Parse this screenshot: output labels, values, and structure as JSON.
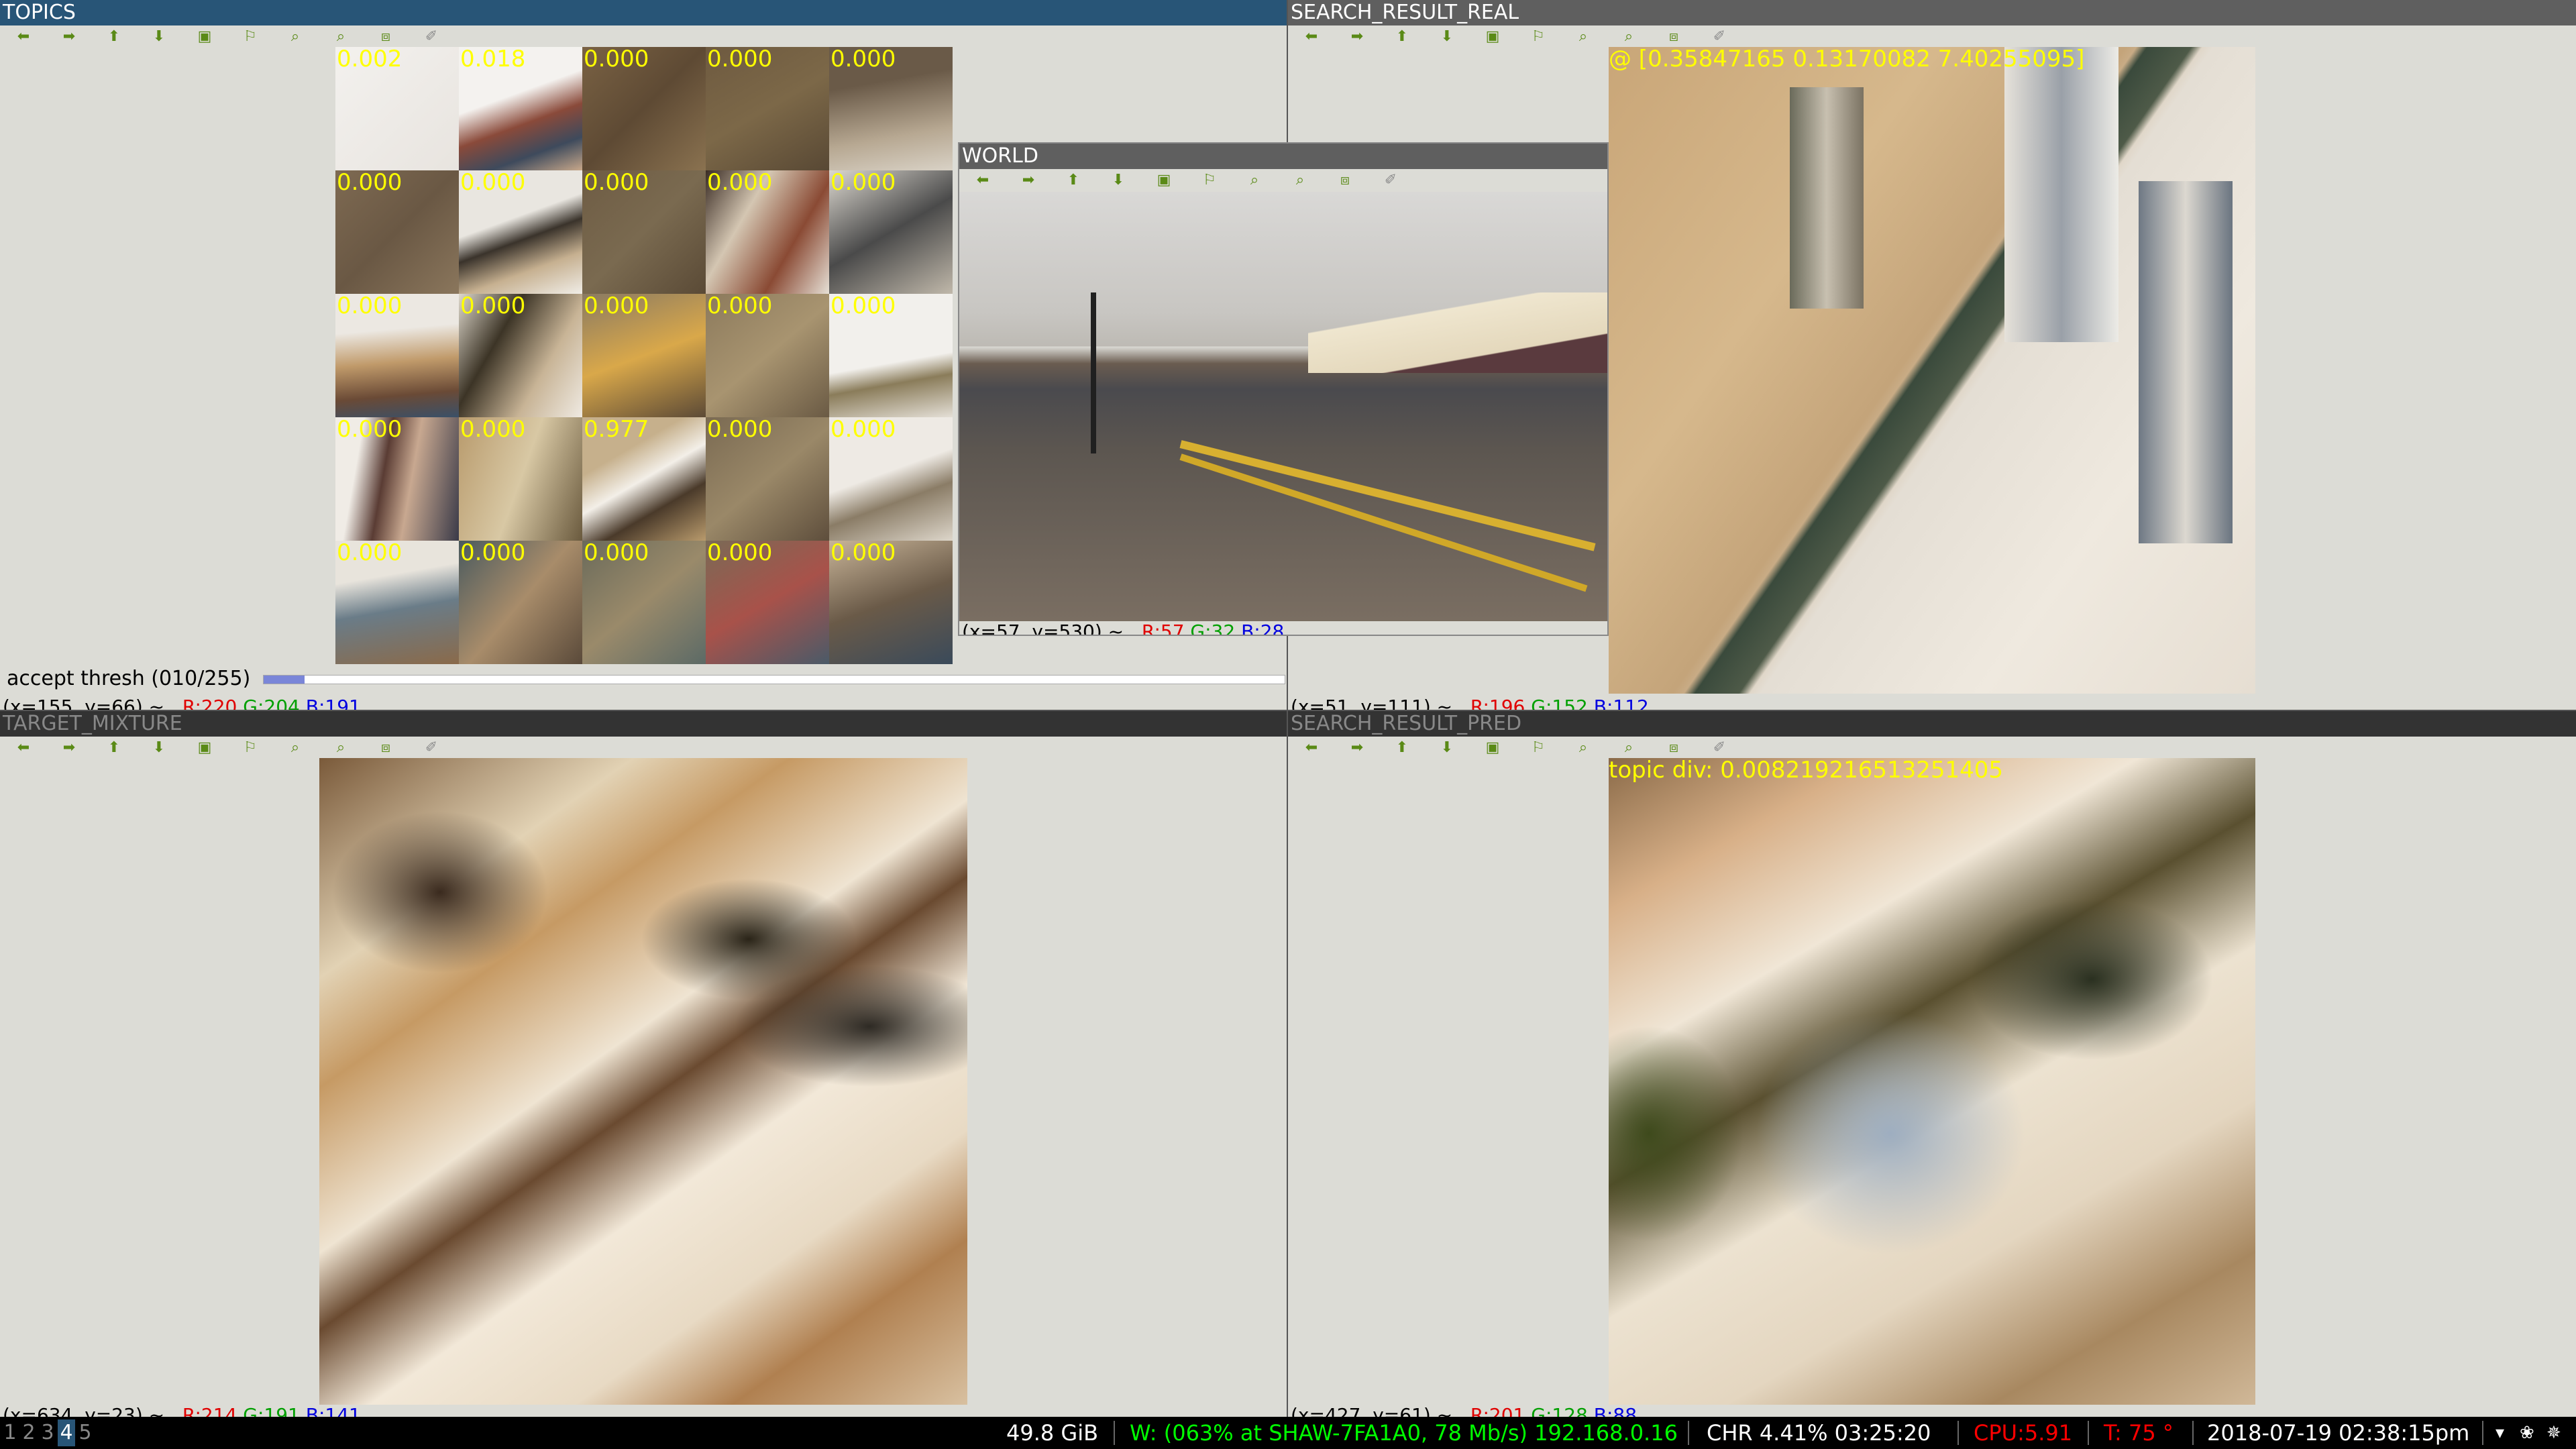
{
  "windows": {
    "topics": {
      "title": "TOPICS",
      "accept_label": "accept thresh (010/255)",
      "slider_level": 0.04,
      "coords": {
        "pos": "(x=155, y=66) ~",
        "r": "R:220",
        "g": "G:204",
        "b": "B:191"
      },
      "grid_values": [
        "0.002",
        "0.018",
        "0.000",
        "0.000",
        "0.000",
        "0.000",
        "0.000",
        "0.000",
        "0.000",
        "0.000",
        "0.000",
        "0.000",
        "0.000",
        "0.000",
        "0.000",
        "0.000",
        "0.000",
        "0.977",
        "0.000",
        "0.000",
        "0.000",
        "0.000",
        "0.000",
        "0.000",
        "0.000"
      ]
    },
    "world": {
      "title": "WORLD",
      "coords": {
        "pos": "(x=57, y=530) ~",
        "r": "R:57",
        "g": "G:32",
        "b": "B:28"
      }
    },
    "search_result_real": {
      "title": "SEARCH_RESULT_REAL",
      "overlay": "@ [0.35847165 0.13170082 7.40255095]",
      "coords": {
        "pos": "(x=51, y=111) ~",
        "r": "R:196",
        "g": "G:152",
        "b": "B:112"
      }
    },
    "target_mixture": {
      "title": "TARGET_MIXTURE",
      "coords": {
        "pos": "(x=634, y=23) ~",
        "r": "R:214",
        "g": "G:191",
        "b": "B:141"
      }
    },
    "search_result_pred": {
      "title": "SEARCH_RESULT_PRED",
      "overlay": "topic div: 0.008219216513251405",
      "coords": {
        "pos": "(x=427, y=61) ~",
        "r": "R:201",
        "g": "G:128",
        "b": "B:88"
      }
    }
  },
  "toolbar_icons": [
    "pan-left-icon",
    "pan-right-icon",
    "pan-up-icon",
    "pan-down-icon",
    "zoom-fit-icon",
    "zoom-in-icon",
    "zoom-out-icon",
    "zoom-original-icon",
    "save-icon",
    "properties-icon"
  ],
  "statusbar": {
    "workspaces": [
      "1",
      "2",
      "3",
      "4",
      "5"
    ],
    "active_workspace": "4",
    "disk": "49.8 GiB",
    "wifi": "W: (063% at SHAW-7FA1A0, 78 Mb/s) 192.168.0.16",
    "battery": "CHR  4.41%  03:25:20",
    "cpu": "CPU:5.91",
    "temp": "T: 75 °",
    "datetime": "2018-07-19 02:38:15pm",
    "colors": {
      "wifi": "#00ff00",
      "cpu": "#ff0000",
      "temp": "#ff0000"
    }
  }
}
